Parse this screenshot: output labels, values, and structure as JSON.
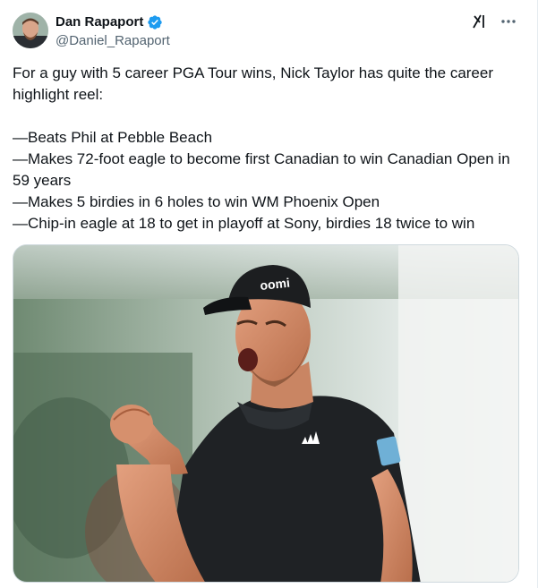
{
  "author": {
    "display_name": "Dan Rapaport",
    "handle": "@Daniel_Rapaport",
    "verified": true,
    "verified_color": "#1d9bf0"
  },
  "actions": {
    "grok_icon": "grok-icon",
    "more_icon": "more-icon"
  },
  "tweet": {
    "line_1": "For a guy with 5 career PGA Tour wins, Nick Taylor has quite the career highlight reel:",
    "items": [
      "—Beats Phil at Pebble Beach",
      "—Makes 72-foot eagle to become first Canadian to win Canadian Open in 59 years",
      "—Makes 5 birdies in 6 holes to win WM Phoenix Open",
      "—Chip-in eagle at 18 to get in playoff at Sony, birdies 18 twice to win"
    ]
  },
  "media": {
    "cap_logo": "oomi"
  },
  "colors": {
    "text": "#0f1419",
    "secondary": "#536471",
    "accent": "#1d9bf0"
  }
}
